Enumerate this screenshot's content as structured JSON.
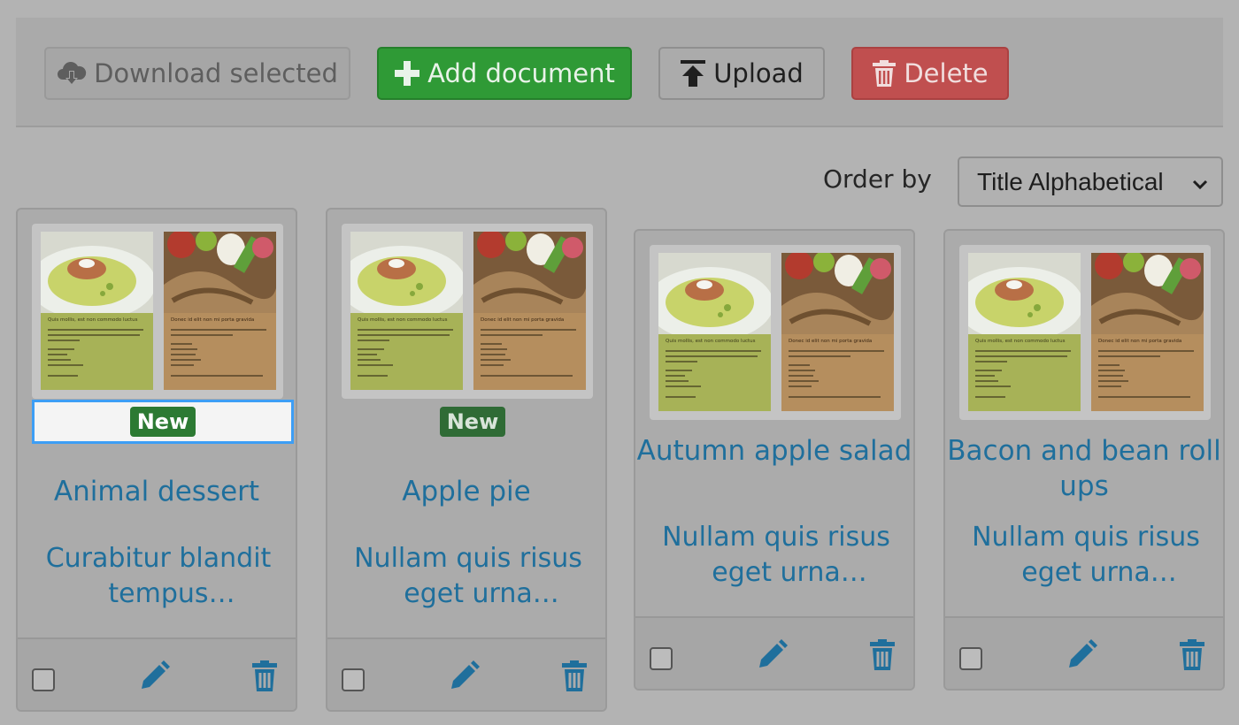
{
  "toolbar": {
    "download_label": "Download selected",
    "add_label": "Add document",
    "upload_label": "Upload",
    "delete_label": "Delete"
  },
  "order": {
    "label": "Order by",
    "selected": "Title Alphabetical"
  },
  "cards": [
    {
      "badge": "New",
      "title": "Animal dessert",
      "description": "Curabitur blandit tempus porttitor...",
      "thumb_left_heading": "Quis mollis, est non commodo luctus",
      "thumb_right_heading": "Donec id elit non mi porta gravida"
    },
    {
      "badge": "New",
      "title": "Apple pie",
      "description": "Nullam quis risus eget urna mollis...",
      "thumb_left_heading": "Quis mollis, est non commodo luctus",
      "thumb_right_heading": "Donec id elit non mi porta gravida"
    },
    {
      "badge": "",
      "title": "Autumn apple salad",
      "description": "Nullam quis risus eget urna mollis...",
      "thumb_left_heading": "Quis mollis, est non commodo luctus",
      "thumb_right_heading": "Donec id elit non mi porta gravida"
    },
    {
      "badge": "",
      "title": "Bacon and bean roll ups",
      "description": "Nullam quis risus eget urna mollis...",
      "thumb_left_heading": "Quis mollis, est non commodo luctus",
      "thumb_right_heading": "Donec id elit non mi porta gravida"
    }
  ],
  "icons": {
    "download": "cloud-download-icon",
    "add": "plus-icon",
    "upload": "upload-icon",
    "delete": "trash-icon",
    "edit": "pencil-icon",
    "select": "chevron-down-icon"
  },
  "colors": {
    "link": "#1f6f9c",
    "success": "#2f9a36",
    "danger": "#c04f4f",
    "focus": "#3d9ef5"
  }
}
